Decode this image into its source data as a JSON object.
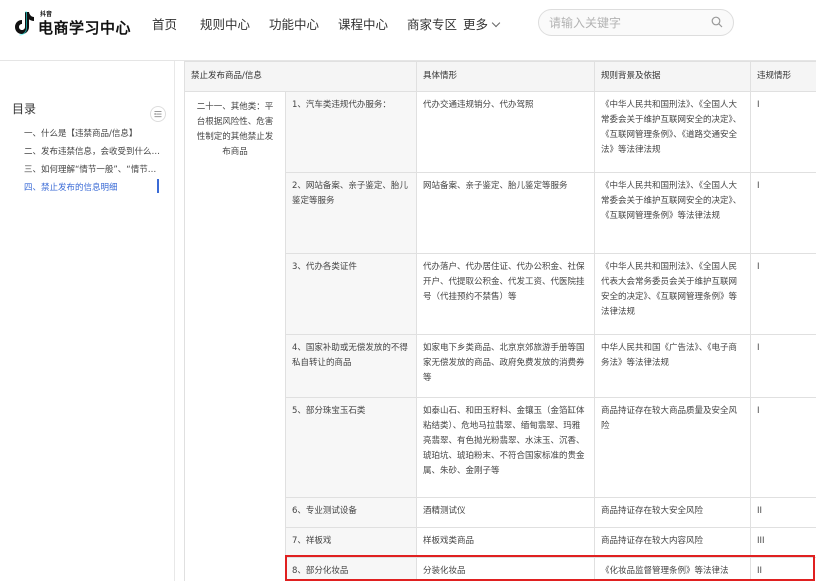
{
  "header": {
    "logo_small": "抖音",
    "logo_text": "电商学习中心",
    "nav": [
      {
        "label": "首页"
      },
      {
        "label": "规则中心"
      },
      {
        "label": "功能中心"
      },
      {
        "label": "课程中心"
      },
      {
        "label": "商家专区"
      },
      {
        "label": "更多"
      }
    ],
    "search_placeholder": "请输入关键字"
  },
  "toc": {
    "title": "目录",
    "items": [
      {
        "label": "一、什么是【违禁商品/信息】",
        "active": false
      },
      {
        "label": "二、发布违禁信息，会收受到什么处罚",
        "active": false
      },
      {
        "label": "三、如何理解“情节一般”、“情节严重”",
        "active": false
      },
      {
        "label": "四、禁止发布的信息明细",
        "active": true
      }
    ]
  },
  "table": {
    "headers": [
      "禁止发布商品/信息",
      "具体情形",
      "规则背景及依据",
      "违规情形"
    ],
    "category": "二十一、其他类：平台根据风险性、危害性制定的其他禁止发布商品",
    "rows": [
      {
        "item": "1、汽车类违规代办服务：",
        "detail": "代办交通违规销分、代办驾照",
        "basis": "《中华人民共和国刑法》、《全国人大常委会关于维护互联网安全的决定》、《互联网管理条例》、《道路交通安全法》等法律法规",
        "level": "I"
      },
      {
        "item": "2、网站备案、亲子鉴定、胎儿鉴定等服务",
        "detail": "网站备案、亲子鉴定、胎儿鉴定等服务",
        "basis": "《中华人民共和国刑法》、《全国人大常委会关于维护互联网安全的决定》、《互联网管理条例》等法律法规",
        "level": "I"
      },
      {
        "item": "3、代办各类证件",
        "detail": "代办落户、代办居住证、代办公积金、社保开户、代提取公积金、代发工资、代医院挂号（代挂预约不禁售）等",
        "basis": "《中华人民共和国刑法》、《全国人民代表大会常务委员会关于维护互联网安全的决定》、《互联网管理条例》等法律法规",
        "level": "I"
      },
      {
        "item": "4、国家补助或无偿发放的不得私自转让的商品",
        "detail": "如家电下乡类商品、北京京郊旅游手册等国家无偿发放的商品、政府免费发放的消费券等",
        "basis": "中华人民共和国《广告法》、《电子商务法》等法律法规",
        "level": "I"
      },
      {
        "item": "5、部分珠宝玉石类",
        "detail": "如泰山石、和田玉籽料、金镶玉（金箔缸体粘结类）、危地马拉翡翠、缅甸翡翠、玛雅亮翡翠、有色抛光粉翡翠、水沫玉、沉香、琥珀坑、琥珀粉末、不符合国家标准的贵金属、朱砂、金刚子等",
        "basis": "商品持证存在较大商品质量及安全风险",
        "level": "I"
      },
      {
        "item": "6、专业测试设备",
        "detail": "酒精测试仪",
        "basis": "商品持证存在较大安全风险",
        "level": "II"
      },
      {
        "item": "7、祥板戏",
        "detail": "样板戏类商品",
        "basis": "商品持证存在较大内容风险",
        "level": "III"
      },
      {
        "item": "8、部分化妆品",
        "detail": "分装化妆品",
        "basis": "《化妆品监督管理条例》等法律法",
        "level": "II"
      }
    ]
  },
  "colors": {
    "highlight": "#e02020",
    "active": "#3b6bd6"
  }
}
